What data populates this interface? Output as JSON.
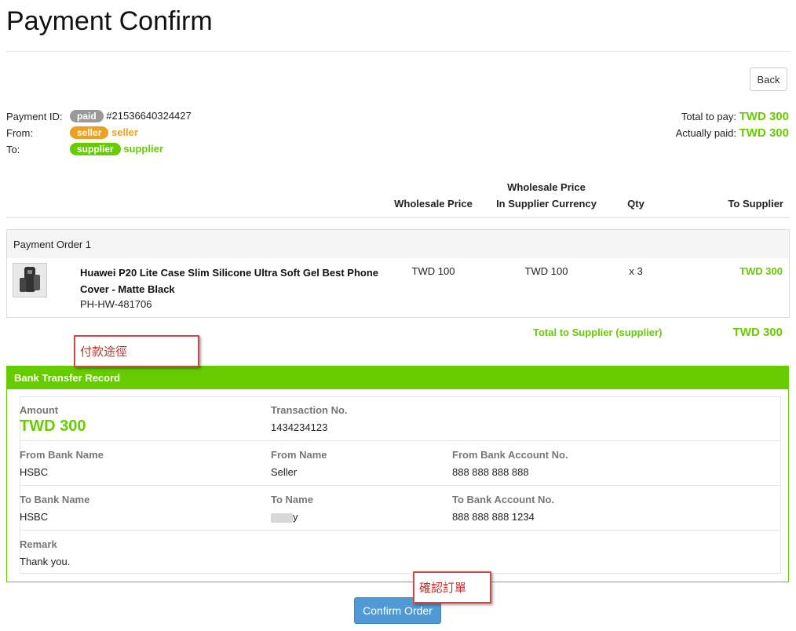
{
  "page": {
    "title": "Payment Confirm",
    "back_label": "Back"
  },
  "payment": {
    "id_label": "Payment ID:",
    "status_badge": "paid",
    "id_value": "#21536640324427",
    "from_label": "From:",
    "from_badge": "seller",
    "from_name": "seller",
    "to_label": "To:",
    "to_badge": "supplier",
    "to_name": "supplier",
    "total_label": "Total to pay:",
    "total_value": "TWD 300",
    "paid_label": "Actually paid:",
    "paid_value": "TWD 300"
  },
  "table": {
    "headers": {
      "wholesale": "Wholesale Price",
      "wholesale_cur_1": "Wholesale Price",
      "wholesale_cur_2": "In Supplier Currency",
      "qty": "Qty",
      "to_supplier": "To Supplier"
    },
    "order_title": "Payment Order 1",
    "item": {
      "name": "Huawei P20 Lite Case Slim Silicone Ultra Soft Gel Best Phone Cover - Matte Black",
      "sku": "PH-HW-481706",
      "wholesale": "TWD 100",
      "wholesale_cur": "TWD 100",
      "qty": "x 3",
      "to_supplier": "TWD 300"
    },
    "total_label": "Total to Supplier (supplier)",
    "total_value": "TWD 300"
  },
  "annotations": {
    "payment_method": "付款途徑",
    "confirm_order": "確認訂單"
  },
  "bank": {
    "title": "Bank Transfer Record",
    "amount_label": "Amount",
    "amount_value": "TWD 300",
    "txn_label": "Transaction No.",
    "txn_value": "1434234123",
    "from_bank_label": "From Bank Name",
    "from_bank_value": "HSBC",
    "from_name_label": "From Name",
    "from_name_value": "Seller",
    "from_acct_label": "From Bank Account No.",
    "from_acct_value": "888 888 888 888",
    "to_bank_label": "To Bank Name",
    "to_bank_value": "HSBC",
    "to_name_label": "To Name",
    "to_name_value": "y",
    "to_acct_label": "To Bank Account No.",
    "to_acct_value": "888 888 888 1234",
    "remark_label": "Remark",
    "remark_value": "Thank you."
  },
  "actions": {
    "confirm_label": "Confirm Order"
  },
  "colors": {
    "accent_green": "#66cc00",
    "orange": "#f0a020",
    "primary_blue": "#4f9ad6",
    "annotation_red": "#d64545"
  }
}
